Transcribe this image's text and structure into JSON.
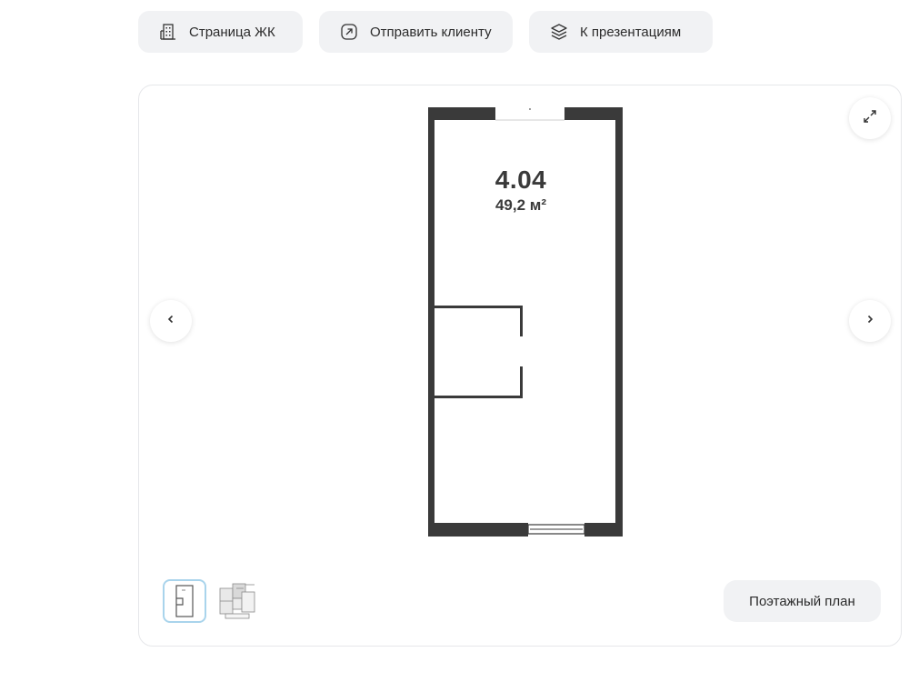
{
  "toolbar": {
    "complex_page": {
      "label": "Страница ЖК",
      "icon": "building-icon"
    },
    "send_client": {
      "label": "Отправить клиенту",
      "icon": "share-arrow-icon"
    },
    "presentations": {
      "label": "К презентациям",
      "icon": "layers-icon"
    }
  },
  "viewer": {
    "apartment_number": "4.04",
    "apartment_area": "49,2 м²",
    "expand_icon": "expand-icon",
    "prev_icon": "chevron-left-icon",
    "next_icon": "chevron-right-icon",
    "thumbnails": [
      {
        "kind": "apartment-plan",
        "active": true
      },
      {
        "kind": "floor-plan",
        "active": false
      }
    ],
    "floor_plan_label": "Поэтажный план"
  },
  "colors": {
    "button_bg": "#f1f2f4",
    "wall": "#3a3a3a",
    "active_thumb_border": "#a9d4ec"
  }
}
